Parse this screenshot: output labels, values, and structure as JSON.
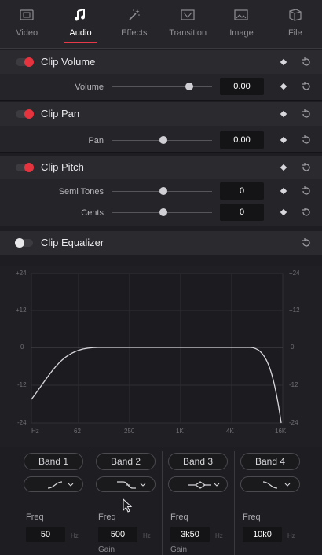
{
  "tabs": [
    {
      "label": "Video",
      "icon": "video-icon",
      "active": false
    },
    {
      "label": "Audio",
      "icon": "music-note-icon",
      "active": true
    },
    {
      "label": "Effects",
      "icon": "magic-wand-icon",
      "active": false
    },
    {
      "label": "Transition",
      "icon": "transition-icon",
      "active": false
    },
    {
      "label": "Image",
      "icon": "image-icon",
      "active": false
    },
    {
      "label": "File",
      "icon": "file-icon",
      "active": false
    }
  ],
  "clip_volume": {
    "title": "Clip Volume",
    "enabled": true,
    "volume_label": "Volume",
    "volume_value": "0.00"
  },
  "clip_pan": {
    "title": "Clip Pan",
    "enabled": true,
    "pan_label": "Pan",
    "pan_value": "0.00"
  },
  "clip_pitch": {
    "title": "Clip Pitch",
    "enabled": true,
    "semitones_label": "Semi Tones",
    "semitones_value": "0",
    "cents_label": "Cents",
    "cents_value": "0"
  },
  "clip_eq": {
    "title": "Clip Equalizer",
    "enabled": false,
    "db_labels": [
      "+24",
      "+12",
      "0",
      "-12",
      "-24"
    ],
    "freq_labels": [
      "Hz",
      "62",
      "250",
      "1K",
      "4K",
      "16K"
    ],
    "bands": [
      {
        "name": "Band 1",
        "shape": "high-pass-shape-icon",
        "freq_label": "Freq",
        "freq": "50",
        "unit": "Hz"
      },
      {
        "name": "Band 2",
        "shape": "low-shelf-shape-icon",
        "freq_label": "Freq",
        "freq": "500",
        "unit": "Hz",
        "gain_label": "Gain"
      },
      {
        "name": "Band 3",
        "shape": "bell-shape-icon",
        "freq_label": "Freq",
        "freq": "3k50",
        "unit": "Hz",
        "gain_label": "Gain"
      },
      {
        "name": "Band 4",
        "shape": "low-pass-shape-icon",
        "freq_label": "Freq",
        "freq": "10k0",
        "unit": "Hz"
      }
    ]
  },
  "colors": {
    "accent": "#e6343f",
    "background": "#1e1e22",
    "panel": "#252529",
    "field": "#141416"
  }
}
